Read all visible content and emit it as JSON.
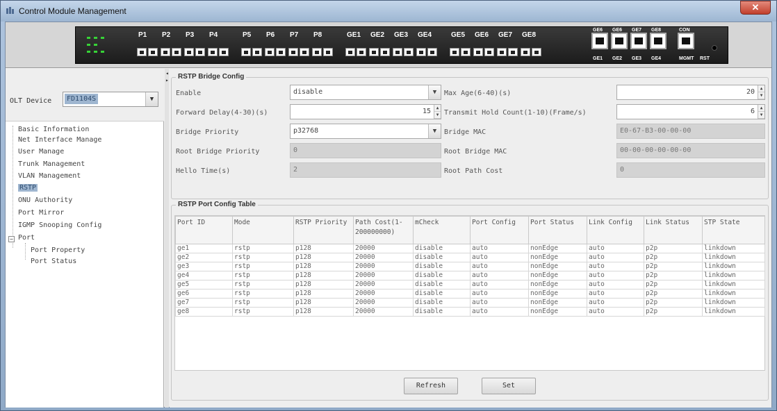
{
  "window": {
    "title": "Control Module Management",
    "close_label": "✕"
  },
  "device": {
    "ports": [
      "P1",
      "P2",
      "P3",
      "P4",
      "P5",
      "P6",
      "P7",
      "P8",
      "GE1",
      "GE2",
      "GE3",
      "GE4",
      "GE5",
      "GE6",
      "GE7",
      "GE8"
    ],
    "rj_top": [
      "GE6",
      "GE6",
      "GE7",
      "GE8",
      "CON"
    ],
    "rj_bottom": [
      "GE1",
      "GE2",
      "GE3",
      "GE4",
      "MGMT",
      "RST"
    ]
  },
  "sidebar": {
    "olt_label": "OLT Device",
    "olt_value": "FD1104S",
    "tree": [
      "Basic Information",
      "Net Interface Manage",
      "User Manage",
      "Trunk Management",
      "VLAN Management",
      "RSTP",
      "ONU Authority",
      "Port Mirror",
      "IGMP Snooping Config",
      "Port",
      "Port Property",
      "Port Status"
    ],
    "toggle": "−"
  },
  "bridge": {
    "title": "RSTP Bridge Config",
    "enable_label": "Enable",
    "enable_value": "disable",
    "max_age_label": "Max Age(6-40)(s)",
    "max_age_value": "20",
    "forward_delay_label": "Forward Delay(4-30)(s)",
    "forward_delay_value": "15",
    "tx_hold_label": "Transmit Hold Count(1-10)(Frame/s)",
    "tx_hold_value": "6",
    "priority_label": "Bridge Priority",
    "priority_value": "p32768",
    "mac_label": "Bridge MAC",
    "mac_value": "E0-67-B3-00-00-00",
    "root_priority_label": "Root Bridge Priority",
    "root_priority_value": "0",
    "root_mac_label": "Root Bridge MAC",
    "root_mac_value": "00-00-00-00-00-00",
    "hello_label": "Hello Time(s)",
    "hello_value": "2",
    "root_cost_label": "Root Path Cost",
    "root_cost_value": "0"
  },
  "port_table": {
    "title": "RSTP Port Config Table",
    "columns": [
      "Port ID",
      "Mode",
      "RSTP Priority",
      "Path Cost(1-200000000)",
      "mCheck",
      "Port Config",
      "Port Status",
      "Link Config",
      "Link Status",
      "STP State"
    ],
    "rows": [
      [
        "ge1",
        "rstp",
        "p128",
        "20000",
        "disable",
        "auto",
        "nonEdge",
        "auto",
        "p2p",
        "linkdown"
      ],
      [
        "ge2",
        "rstp",
        "p128",
        "20000",
        "disable",
        "auto",
        "nonEdge",
        "auto",
        "p2p",
        "linkdown"
      ],
      [
        "ge3",
        "rstp",
        "p128",
        "20000",
        "disable",
        "auto",
        "nonEdge",
        "auto",
        "p2p",
        "linkdown"
      ],
      [
        "ge4",
        "rstp",
        "p128",
        "20000",
        "disable",
        "auto",
        "nonEdge",
        "auto",
        "p2p",
        "linkdown"
      ],
      [
        "ge5",
        "rstp",
        "p128",
        "20000",
        "disable",
        "auto",
        "nonEdge",
        "auto",
        "p2p",
        "linkdown"
      ],
      [
        "ge6",
        "rstp",
        "p128",
        "20000",
        "disable",
        "auto",
        "nonEdge",
        "auto",
        "p2p",
        "linkdown"
      ],
      [
        "ge7",
        "rstp",
        "p128",
        "20000",
        "disable",
        "auto",
        "nonEdge",
        "auto",
        "p2p",
        "linkdown"
      ],
      [
        "ge8",
        "rstp",
        "p128",
        "20000",
        "disable",
        "auto",
        "nonEdge",
        "auto",
        "p2p",
        "linkdown"
      ]
    ]
  },
  "buttons": {
    "refresh": "Refresh",
    "set": "Set"
  }
}
